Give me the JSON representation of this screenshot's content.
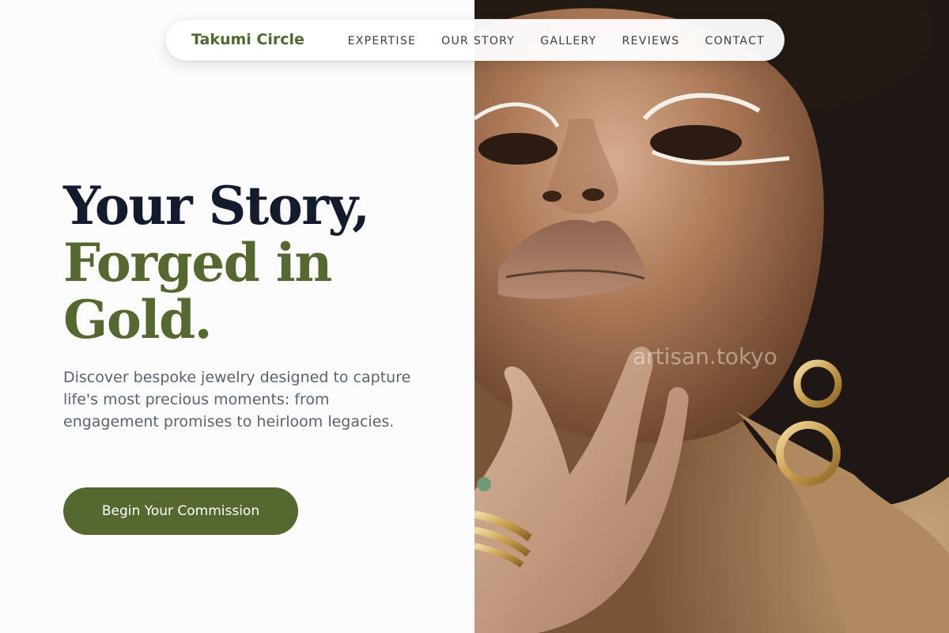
{
  "nav": {
    "brand": "Takumi Circle",
    "links": [
      {
        "label": "EXPERTISE"
      },
      {
        "label": "OUR STORY"
      },
      {
        "label": "GALLERY"
      },
      {
        "label": "REVIEWS"
      },
      {
        "label": "CONTACT"
      }
    ]
  },
  "hero": {
    "headline_line1": "Your Story,",
    "headline_line2": "Forged in",
    "headline_line3": "Gold.",
    "subtitle": "Discover bespoke jewelry designed to capture life's most precious moments: from engagement promises to heirloom legacies.",
    "cta_label": "Begin Your Commission",
    "image_alt": "Close-up portrait of a woman wearing gold hoop earrings and gold rings",
    "watermark": "artisan.tokyo"
  },
  "colors": {
    "accent_green": "#56682f",
    "headline_dark": "#141b2d",
    "body_text": "#5b6271",
    "background": "#fcfcfc"
  }
}
